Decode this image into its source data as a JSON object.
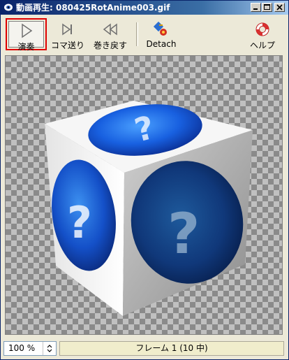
{
  "window": {
    "title": "動画再生: 080425RotAnime003.gif",
    "icons": [
      "app-icon",
      "minimize-icon",
      "maximize-icon",
      "close-icon"
    ]
  },
  "toolbar": {
    "play_label": "演奏",
    "step_label": "コマ送り",
    "rewind_label": "巻き戻す",
    "detach_label": "Detach",
    "help_label": "ヘルプ"
  },
  "image": {
    "checker_colors": [
      "#c0c0c0",
      "#8a8a8a"
    ],
    "cube_face_color": "#ffffff",
    "orb_color": "#1050c8"
  },
  "status": {
    "zoom_value": "100 %",
    "frame_text": "フレーム 1 (10 中)"
  }
}
